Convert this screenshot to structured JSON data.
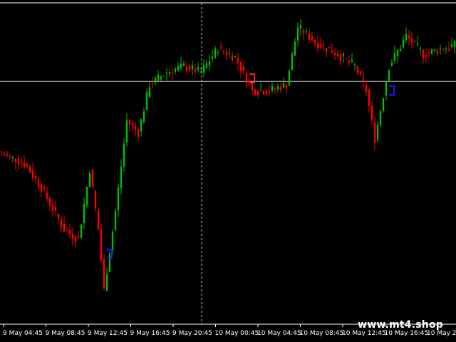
{
  "chart_data": {
    "type": "candlestick",
    "title": "",
    "xlabel": "",
    "ylabel": "",
    "x_ticks": [
      "9 May 04:45",
      "9 May 08:45",
      "9 May 12:45",
      "9 May 16:45",
      "9 May 20:45",
      "10 May 00:45",
      "10 May 04:45",
      "10 May 08:45",
      "10 May 12:45",
      "10 May 16:45",
      "10 May 20:..."
    ],
    "price_levels": {
      "start": 0.55,
      "min": 0.0,
      "max": 1.0
    },
    "path_anchors": [
      {
        "bar": 0,
        "value": 0.55
      },
      {
        "bar": 8,
        "value": 0.52
      },
      {
        "bar": 14,
        "value": 0.44
      },
      {
        "bar": 22,
        "value": 0.3
      },
      {
        "bar": 27,
        "value": 0.27
      },
      {
        "bar": 31,
        "value": 0.5
      },
      {
        "bar": 34,
        "value": 0.3
      },
      {
        "bar": 36,
        "value": 0.1
      },
      {
        "bar": 40,
        "value": 0.36
      },
      {
        "bar": 44,
        "value": 0.66
      },
      {
        "bar": 48,
        "value": 0.62
      },
      {
        "bar": 52,
        "value": 0.78
      },
      {
        "bar": 58,
        "value": 0.82
      },
      {
        "bar": 64,
        "value": 0.84
      },
      {
        "bar": 70,
        "value": 0.82
      },
      {
        "bar": 76,
        "value": 0.9
      },
      {
        "bar": 82,
        "value": 0.87
      },
      {
        "bar": 88,
        "value": 0.76
      },
      {
        "bar": 94,
        "value": 0.76
      },
      {
        "bar": 100,
        "value": 0.78
      },
      {
        "bar": 104,
        "value": 0.97
      },
      {
        "bar": 110,
        "value": 0.92
      },
      {
        "bar": 118,
        "value": 0.88
      },
      {
        "bar": 124,
        "value": 0.84
      },
      {
        "bar": 128,
        "value": 0.76
      },
      {
        "bar": 131,
        "value": 0.6
      },
      {
        "bar": 136,
        "value": 0.84
      },
      {
        "bar": 142,
        "value": 0.94
      },
      {
        "bar": 148,
        "value": 0.88
      },
      {
        "bar": 155,
        "value": 0.9
      }
    ],
    "crosshair_price": 0.79,
    "crosshair_time": "9 May 20:45",
    "signals": [
      {
        "bar": 38,
        "value": 0.22,
        "color": "#1a1aff"
      },
      {
        "bar": 88,
        "value": 0.8,
        "color": "#ff2020"
      },
      {
        "bar": 137,
        "value": 0.76,
        "color": "#1a1aff"
      }
    ],
    "colors": {
      "bullish": "#00c000",
      "bearish": "#ff0000",
      "grid": "#ffffff",
      "crosshair": "#c8c8c8",
      "background": "#000000"
    },
    "grid": false
  },
  "watermark": "www.mt4.shop"
}
